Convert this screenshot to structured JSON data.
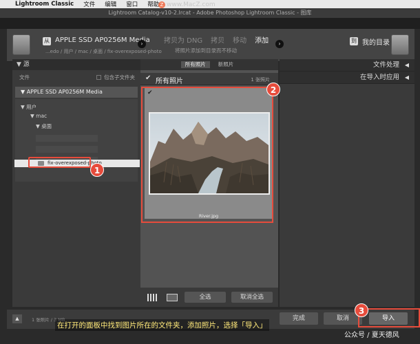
{
  "menubar": {
    "apple_icon": "apple-icon",
    "app": "Lightroom Classic",
    "items": [
      "文件",
      "编辑",
      "窗口",
      "帮助"
    ]
  },
  "window": {
    "title": "Lightroom Catalog-v10-2.lrcat - Adobe Photoshop Lightroom Classic - 图库",
    "watermark": "www.MacZ.com",
    "watermark_badge": "Z"
  },
  "header": {
    "source_badge": "从",
    "source_name": "APPLE SSD AP0256M Media",
    "source_path": "...edo / 用户 / mac / 桌面 / fix-overexposed-photo",
    "arrow_icon": "arrow-right-icon",
    "modes": [
      "拷贝为 DNG",
      "拷贝",
      "移动",
      "添加"
    ],
    "active_mode": "添加",
    "mode_desc": "将照片添加到目录而不移动",
    "dest_badge": "到",
    "dest_name": "我的目录"
  },
  "left": {
    "title": "▼ 源",
    "files_label": "文件",
    "include_subfolders": "包含子文件夹",
    "volume": "▼ APPLE SSD AP0256M Media",
    "tree": [
      "▼ 用户",
      "▼ mac",
      "▼ 桌面"
    ],
    "selected_folder": "fix-overexposed-photo"
  },
  "center": {
    "tabs": [
      "所有照片",
      "新照片"
    ],
    "all_photos_label": "所有照片",
    "photo_count": "1 张照片",
    "photo_name": "River.jpg",
    "select_all": "全选",
    "deselect_all": "取消全选"
  },
  "right": {
    "sections": [
      "文件处理",
      "在导入时应用"
    ]
  },
  "bottom": {
    "count_text": "1 张照片 / 3 MB",
    "done": "完成",
    "cancel": "取消",
    "import": "导入"
  },
  "annotations": {
    "badges": [
      "1",
      "2",
      "3"
    ],
    "caption": "在打开的面板中找到图片所在的文件夹，添加照片，选择「导入」",
    "social": "公众号 / 夏天德风"
  },
  "colors": {
    "highlight": "#e74c3c",
    "caption": "#ffe97a",
    "panel": "#3a3a3a"
  }
}
